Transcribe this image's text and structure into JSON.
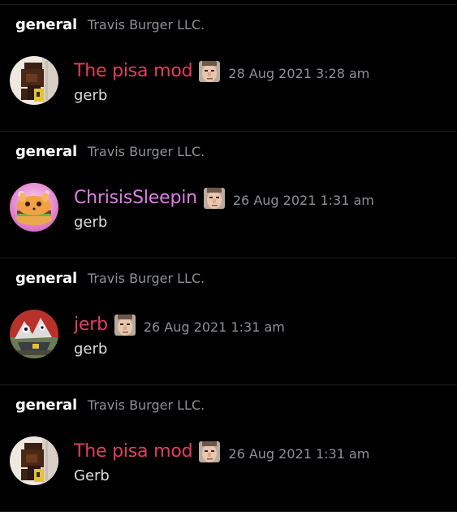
{
  "messages": [
    {
      "channel": "general",
      "server": "Travis Burger LLC.",
      "username": "The pisa mod",
      "username_color": "#e23e5e",
      "avatar": "pixel-character-avatar",
      "role_icon": "face-badge-icon",
      "timestamp": "28 Aug 2021 3:28 am",
      "content": "gerb"
    },
    {
      "channel": "general",
      "server": "Travis Burger LLC.",
      "username": "ChrisisSleepin",
      "username_color": "#e07ee8",
      "avatar": "burger-creature-avatar",
      "role_icon": "face-badge-icon",
      "timestamp": "26 Aug 2021 1:31 am",
      "content": "gerb"
    },
    {
      "channel": "general",
      "server": "Travis Burger LLC.",
      "username": "jerb",
      "username_color": "#e23e5e",
      "avatar": "cartoon-scene-avatar",
      "role_icon": "face-badge-icon",
      "timestamp": "26 Aug 2021 1:31 am",
      "content": "gerb"
    },
    {
      "channel": "general",
      "server": "Travis Burger LLC.",
      "username": "The pisa mod",
      "username_color": "#e23e5e",
      "avatar": "pixel-character-avatar",
      "role_icon": "face-badge-icon",
      "timestamp": "26 Aug 2021 1:31 am",
      "content": "Gerb"
    }
  ]
}
